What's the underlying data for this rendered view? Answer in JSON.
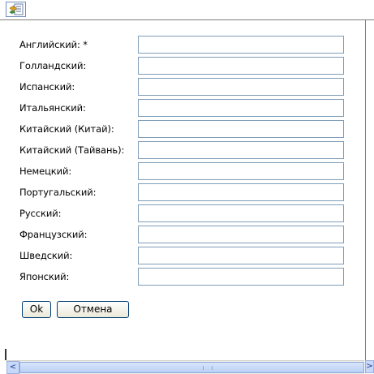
{
  "toolbar": {
    "icon": "translate-icon"
  },
  "form": {
    "rows": [
      {
        "label": "Английский: *",
        "value": ""
      },
      {
        "label": "Голландский:",
        "value": ""
      },
      {
        "label": "Испанский:",
        "value": ""
      },
      {
        "label": "Итальянский:",
        "value": ""
      },
      {
        "label": "Китайский (Китай):",
        "value": ""
      },
      {
        "label": "Китайский (Тайвань):",
        "value": ""
      },
      {
        "label": "Немецкий:",
        "value": ""
      },
      {
        "label": "Португальский:",
        "value": ""
      },
      {
        "label": "Русский:",
        "value": ""
      },
      {
        "label": "Французский:",
        "value": ""
      },
      {
        "label": "Шведский:",
        "value": ""
      },
      {
        "label": "Японский:",
        "value": ""
      }
    ]
  },
  "buttons": {
    "ok": "Ok",
    "cancel": "Отмена"
  },
  "scrollbar": {
    "left_arrow": "<",
    "right_arrow": ">"
  }
}
